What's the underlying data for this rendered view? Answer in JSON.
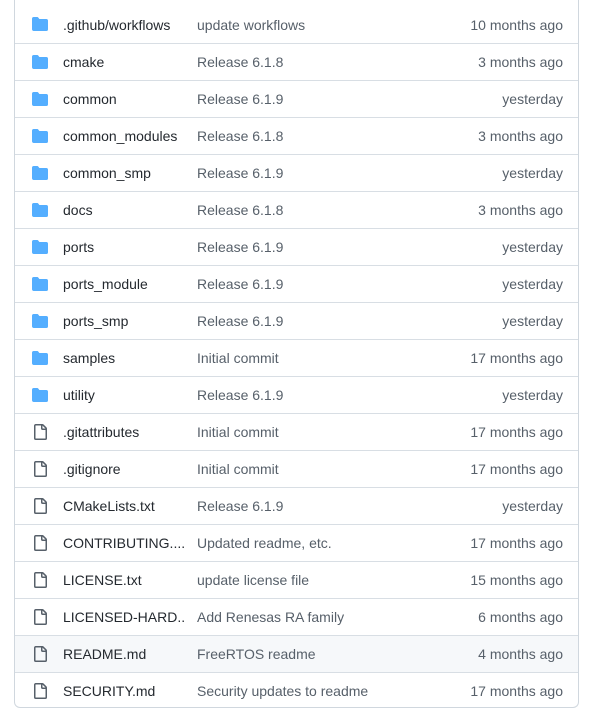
{
  "colors": {
    "folder_icon": "#54aeff",
    "file_icon": "#57606a",
    "text_primary": "#24292f",
    "text_muted": "#57606a",
    "border": "#d0d7de",
    "row_highlight": "#f6f8fa"
  },
  "entries": [
    {
      "type": "folder",
      "icon": "folder-icon",
      "name": ".github/workflows",
      "message": "update workflows",
      "age": "10 months ago"
    },
    {
      "type": "folder",
      "icon": "folder-icon",
      "name": "cmake",
      "message": "Release 6.1.8",
      "age": "3 months ago"
    },
    {
      "type": "folder",
      "icon": "folder-icon",
      "name": "common",
      "message": "Release 6.1.9",
      "age": "yesterday"
    },
    {
      "type": "folder",
      "icon": "folder-icon",
      "name": "common_modules",
      "message": "Release 6.1.8",
      "age": "3 months ago"
    },
    {
      "type": "folder",
      "icon": "folder-icon",
      "name": "common_smp",
      "message": "Release 6.1.9",
      "age": "yesterday"
    },
    {
      "type": "folder",
      "icon": "folder-icon",
      "name": "docs",
      "message": "Release 6.1.8",
      "age": "3 months ago"
    },
    {
      "type": "folder",
      "icon": "folder-icon",
      "name": "ports",
      "message": "Release 6.1.9",
      "age": "yesterday"
    },
    {
      "type": "folder",
      "icon": "folder-icon",
      "name": "ports_module",
      "message": "Release 6.1.9",
      "age": "yesterday"
    },
    {
      "type": "folder",
      "icon": "folder-icon",
      "name": "ports_smp",
      "message": "Release 6.1.9",
      "age": "yesterday"
    },
    {
      "type": "folder",
      "icon": "folder-icon",
      "name": "samples",
      "message": "Initial commit",
      "age": "17 months ago"
    },
    {
      "type": "folder",
      "icon": "folder-icon",
      "name": "utility",
      "message": "Release 6.1.9",
      "age": "yesterday"
    },
    {
      "type": "file",
      "icon": "file-icon",
      "name": ".gitattributes",
      "message": "Initial commit",
      "age": "17 months ago"
    },
    {
      "type": "file",
      "icon": "file-icon",
      "name": ".gitignore",
      "message": "Initial commit",
      "age": "17 months ago"
    },
    {
      "type": "file",
      "icon": "file-icon",
      "name": "CMakeLists.txt",
      "message": "Release 6.1.9",
      "age": "yesterday"
    },
    {
      "type": "file",
      "icon": "file-icon",
      "name": "CONTRIBUTING....",
      "message": "Updated readme, etc.",
      "age": "17 months ago"
    },
    {
      "type": "file",
      "icon": "file-icon",
      "name": "LICENSE.txt",
      "message": "update license file",
      "age": "15 months ago"
    },
    {
      "type": "file",
      "icon": "file-icon",
      "name": "LICENSED-HARD...",
      "message": "Add Renesas RA family",
      "age": "6 months ago"
    },
    {
      "type": "file",
      "icon": "file-icon",
      "name": "README.md",
      "message": "FreeRTOS readme",
      "age": "4 months ago",
      "highlighted": true
    },
    {
      "type": "file",
      "icon": "file-icon",
      "name": "SECURITY.md",
      "message": "Security updates to readme",
      "age": "17 months ago"
    }
  ]
}
